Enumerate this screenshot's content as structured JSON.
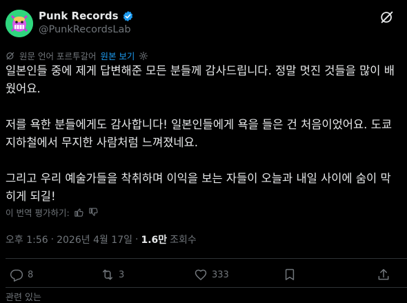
{
  "author": {
    "display_name": "Punk Records",
    "handle": "@PunkRecordsLab"
  },
  "translation_bar": {
    "original_language_text": "원문 언어 포르투갈어",
    "show_original_label": "원본 보기"
  },
  "tweet": {
    "paragraphs": [
      "일본인들 중에 제게 답변해준 모든 분들께 감사드립니다. 정말 멋진 것들을 많이 배웠어요.",
      "저를 욕한 분들에게도 감사합니다! 일본인들에게 욕을 들은 건 처음이었어요. 도쿄 지하철에서 무지한 사람처럼 느껴졌네요.",
      "그리고 우리 예술가들을 착취하며 이익을 보는 자들이 오늘과 내일 사이에 숨이 막히게 되길!"
    ]
  },
  "rate_translation_label": "이 번역 평가하기:",
  "meta": {
    "time": "오후 1:56",
    "separator": "·",
    "date": "2026년 4월 17일",
    "views_count": "1.6만",
    "views_label": "조회수"
  },
  "actions": {
    "replies": "8",
    "reposts": "3",
    "likes": "333"
  },
  "bottom_text": "관련 있는"
}
